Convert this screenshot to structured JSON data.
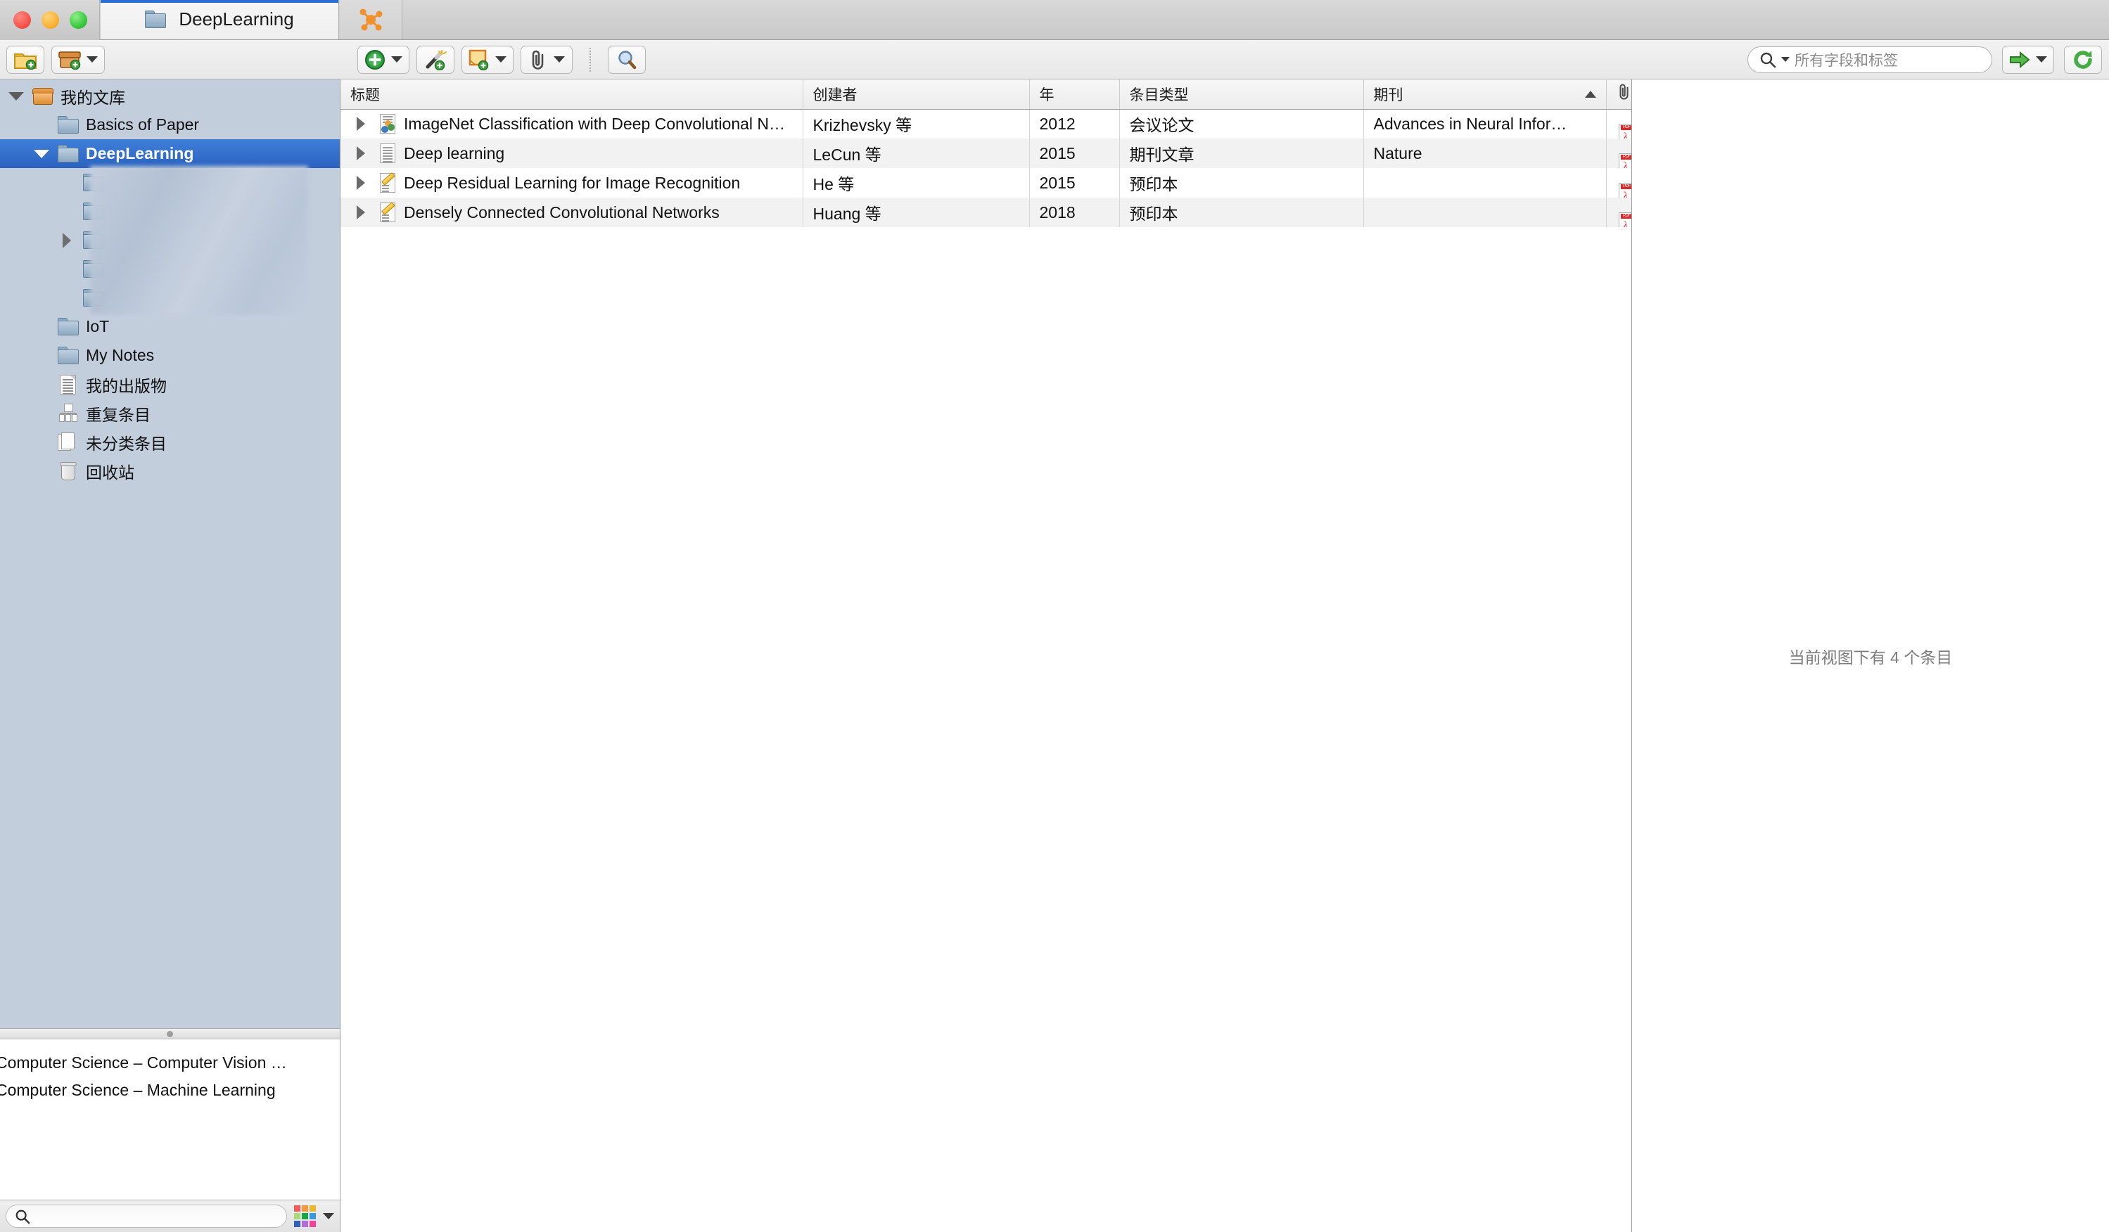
{
  "window": {
    "traffic_lights": [
      "close",
      "minimize",
      "zoom"
    ]
  },
  "tabs": [
    {
      "label": "DeepLearning",
      "icon": "folder-icon",
      "active": true
    },
    {
      "label": "",
      "icon": "molecule-icon",
      "active": false
    }
  ],
  "toolbar": {
    "left_buttons": [
      {
        "name": "new-collection-button",
        "icon": "new-folder-icon",
        "has_caret": false
      },
      {
        "name": "new-library-button",
        "icon": "new-library-icon",
        "has_caret": true
      }
    ],
    "mid_buttons": [
      {
        "name": "new-item-button",
        "icon": "green-plus-icon",
        "has_caret": true
      },
      {
        "name": "add-item-by-identifier-button",
        "icon": "magic-wand-icon",
        "has_caret": false
      },
      {
        "name": "new-note-button",
        "icon": "new-note-icon",
        "has_caret": true
      },
      {
        "name": "add-attachment-button",
        "icon": "paperclip-icon",
        "has_caret": true
      },
      {
        "name": "advanced-search-button",
        "icon": "magnifier-icon",
        "has_caret": false
      }
    ],
    "search": {
      "placeholder": "所有字段和标签",
      "value": "",
      "icon": "search-icon",
      "has_caret": true
    },
    "locate_button": {
      "icon": "green-arrow-icon",
      "has_caret": true
    },
    "sync_button": {
      "icon": "sync-icon"
    }
  },
  "sidebar": {
    "items": [
      {
        "label": "我的文库",
        "icon": "library-icon",
        "indent": 0,
        "twisty": "down",
        "selected": false
      },
      {
        "label": "Basics of Paper",
        "icon": "folder-icon",
        "indent": 1,
        "twisty": "none",
        "selected": false
      },
      {
        "label": "DeepLearning",
        "icon": "folder-icon",
        "indent": 1,
        "twisty": "down",
        "selected": true
      },
      {
        "label": "",
        "icon": "folder-icon",
        "indent": 2,
        "twisty": "none",
        "selected": false,
        "redacted": true
      },
      {
        "label": "",
        "icon": "folder-icon",
        "indent": 2,
        "twisty": "none",
        "selected": false,
        "redacted": true
      },
      {
        "label": "",
        "icon": "folder-icon",
        "indent": 2,
        "twisty": "right",
        "selected": false,
        "redacted": true
      },
      {
        "label": "",
        "icon": "folder-icon",
        "indent": 2,
        "twisty": "none",
        "selected": false,
        "redacted": true
      },
      {
        "label": "",
        "icon": "folder-icon",
        "indent": 2,
        "twisty": "none",
        "selected": false,
        "redacted": true
      },
      {
        "label": "IoT",
        "icon": "folder-icon",
        "indent": 1,
        "twisty": "none",
        "selected": false
      },
      {
        "label": "My Notes",
        "icon": "folder-icon",
        "indent": 1,
        "twisty": "none",
        "selected": false
      },
      {
        "label": "我的出版物",
        "icon": "document-icon",
        "indent": 1,
        "twisty": "none",
        "selected": false
      },
      {
        "label": "重复条目",
        "icon": "duplicates-icon",
        "indent": 1,
        "twisty": "none",
        "selected": false
      },
      {
        "label": "未分类条目",
        "icon": "unfiled-icon",
        "indent": 1,
        "twisty": "none",
        "selected": false
      },
      {
        "label": "回收站",
        "icon": "trash-icon",
        "indent": 1,
        "twisty": "none",
        "selected": false
      }
    ]
  },
  "tag_selector": {
    "tags": [
      "Computer Science – Computer Vision …",
      "Computer Science – Machine Learning"
    ],
    "filter_placeholder": "",
    "filter_value": "",
    "color_grid": [
      "#f45b5b",
      "#f59a3c",
      "#e8b830",
      "#a9d97a",
      "#18a747",
      "#3a9ae0",
      "#2f5fbf",
      "#b06ddb",
      "#f0439b"
    ]
  },
  "items_table": {
    "columns": [
      {
        "key": "title",
        "label": "标题",
        "sorted": false
      },
      {
        "key": "creator",
        "label": "创建者",
        "sorted": false
      },
      {
        "key": "year",
        "label": "年",
        "sorted": false
      },
      {
        "key": "item_type",
        "label": "条目类型",
        "sorted": false
      },
      {
        "key": "publication",
        "label": "期刊",
        "sorted": true,
        "sort_dir": "asc"
      },
      {
        "key": "attachment",
        "label": "",
        "icon": "paperclip-icon",
        "sorted": false
      }
    ],
    "rows": [
      {
        "title": "ImageNet Classification with Deep Convolutional Ne…",
        "creator": "Krizhevsky 等",
        "year": "2012",
        "item_type": "会议论文",
        "publication": "Advances in Neural Infor…",
        "attachment": "pdf-icon",
        "type_icon": "conference-paper-icon"
      },
      {
        "title": "Deep learning",
        "creator": "LeCun 等",
        "year": "2015",
        "item_type": "期刊文章",
        "publication": "Nature",
        "attachment": "pdf-icon",
        "type_icon": "journal-article-icon"
      },
      {
        "title": "Deep Residual Learning for Image Recognition",
        "creator": "He 等",
        "year": "2015",
        "item_type": "预印本",
        "publication": "",
        "attachment": "pdf-icon",
        "type_icon": "preprint-icon"
      },
      {
        "title": "Densely Connected Convolutional Networks",
        "creator": "Huang 等",
        "year": "2018",
        "item_type": "预印本",
        "publication": "",
        "attachment": "pdf-icon",
        "type_icon": "preprint-icon"
      }
    ]
  },
  "right_pane": {
    "empty_message": "当前视图下有 4 个条目"
  },
  "colors": {
    "selection_blue": "#2a62c0",
    "tab_accent": "#2a6fd6",
    "sidebar_bg": "#c3cedd",
    "pdf_red": "#d92b2b",
    "green_accent": "#2a9b3d"
  }
}
